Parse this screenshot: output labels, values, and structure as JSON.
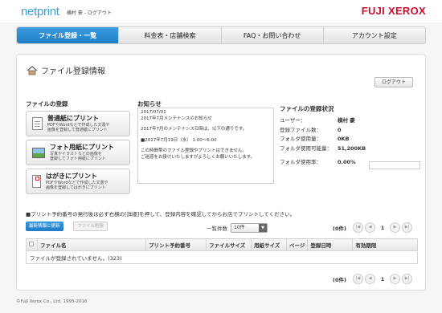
{
  "header": {
    "logo": "netprint",
    "user_name": "横村 豪",
    "separator": " - ",
    "logout_link": "ログアウト",
    "brand": "FUJI XEROX"
  },
  "nav": {
    "items": [
      {
        "label": "ファイル登録・一覧",
        "active": true
      },
      {
        "label": "料金表・店舗検索",
        "active": false
      },
      {
        "label": "FAQ・お問い合わせ",
        "active": false
      },
      {
        "label": "アカウント設定",
        "active": false
      }
    ]
  },
  "main": {
    "title": "ファイル登録情報",
    "logout_button": "ログアウト",
    "register": {
      "heading": "ファイルの登録",
      "buttons": [
        {
          "title": "普通紙にプリント",
          "line1": "PDFやWordなどで作成した文書や",
          "line2": "画像を登録して普通紙にプリント"
        },
        {
          "title": "フォト用紙にプリント",
          "line1": "写真やイラストなどの画像を",
          "line2": "登録してフォト用紙にプリント"
        },
        {
          "title": "はがきにプリント",
          "line1": "PDFやWordなどで作成した文書や",
          "line2": "画像を登録してはがきにプリント"
        }
      ]
    },
    "notice": {
      "heading": "お知らせ",
      "lines": [
        "2017/07/01",
        "2017年7月メンテナンスのお知らせ",
        "",
        "2017年7月のメンテナンス日時は、以下の通りです。",
        "",
        "■2017年7月19日（水） 1:00〜6:00",
        "",
        "この時間帯のファイル登録やプリントはできません。",
        "ご迷惑をお掛けいたしますがよろしくお願いいたします。"
      ]
    },
    "status": {
      "heading": "ファイルの登録状況",
      "rows": [
        {
          "label": "ユーザー：",
          "value": "横村 豪"
        },
        {
          "label": "登録ファイル数：",
          "value": "0"
        },
        {
          "label": "フォルダ使用量：",
          "value": "0KB"
        },
        {
          "label": "フォルダ使用可能量：",
          "value": "51,200KB"
        },
        {
          "label": "フォルダ使用率：",
          "value": "0.00%"
        }
      ],
      "usage_fraction": 0.0
    },
    "instruction": "■プリント予約番号の発行後は必ず右横の[詳細]を押して、登録内容を確認してからお店でプリントしてください。",
    "refresh_button": "最新情報に更新",
    "delete_button": "ファイル削除",
    "per_page_label": "一覧件数",
    "per_page_value": "10件",
    "pager": {
      "count": "(0件)",
      "page": "1"
    },
    "table": {
      "columns": [
        "ファイル名",
        "プリント予約番号",
        "ファイルサイズ",
        "用紙サイズ",
        "ページ",
        "登録日時",
        "有効期限"
      ],
      "empty_message": "ファイルが登録されていません。(323)"
    }
  },
  "footer": {
    "copyright": "©Fuji Xerox Co., Ltd. 1995-2016"
  }
}
